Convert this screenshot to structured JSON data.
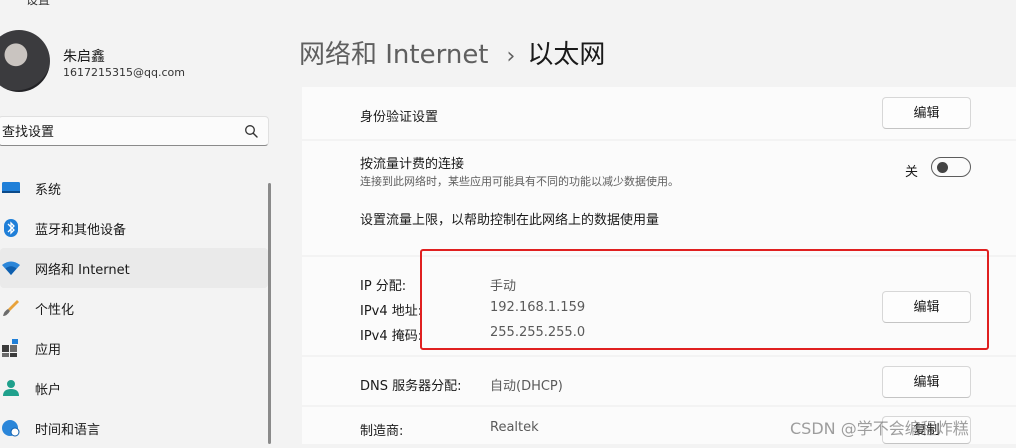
{
  "app": {
    "title": "设置"
  },
  "user": {
    "name": "朱启鑫",
    "email": "1617215315@qq.com"
  },
  "search": {
    "value": "查找设置"
  },
  "nav": {
    "items": [
      {
        "label": "系统"
      },
      {
        "label": "蓝牙和其他设备"
      },
      {
        "label": "网络和 Internet",
        "active": true
      },
      {
        "label": "个性化"
      },
      {
        "label": "应用"
      },
      {
        "label": "帐户"
      },
      {
        "label": "时间和语言"
      }
    ]
  },
  "header": {
    "parent": "网络和 Internet",
    "separator": "›",
    "current": "以太网"
  },
  "settings": {
    "auth": {
      "label": "身份验证设置",
      "button": "编辑"
    },
    "metered": {
      "label": "按流量计费的连接",
      "description": "连接到此网络时，某些应用可能具有不同的功能以减少数据使用。",
      "toggle_label": "关",
      "toggle_on": false
    },
    "data_limit": {
      "link": "设置流量上限，以帮助控制在此网络上的数据使用量"
    },
    "ip": {
      "assignment_label": "IP 分配:",
      "assignment_value": "手动",
      "ipv4_label": "IPv4 地址:",
      "ipv4_value": "192.168.1.159",
      "mask_label": "IPv4 掩码:",
      "mask_value": "255.255.255.0",
      "button": "编辑"
    },
    "dns": {
      "label": "DNS 服务器分配:",
      "value": "自动(DHCP)",
      "button": "编辑"
    },
    "manufacturer": {
      "label": "制造商:",
      "value": "Realtek",
      "button": "复制"
    }
  },
  "watermark": "CSDN @学不会编程炸糕",
  "colors": {
    "accent": "#0067c0",
    "highlight": "#e02020"
  }
}
